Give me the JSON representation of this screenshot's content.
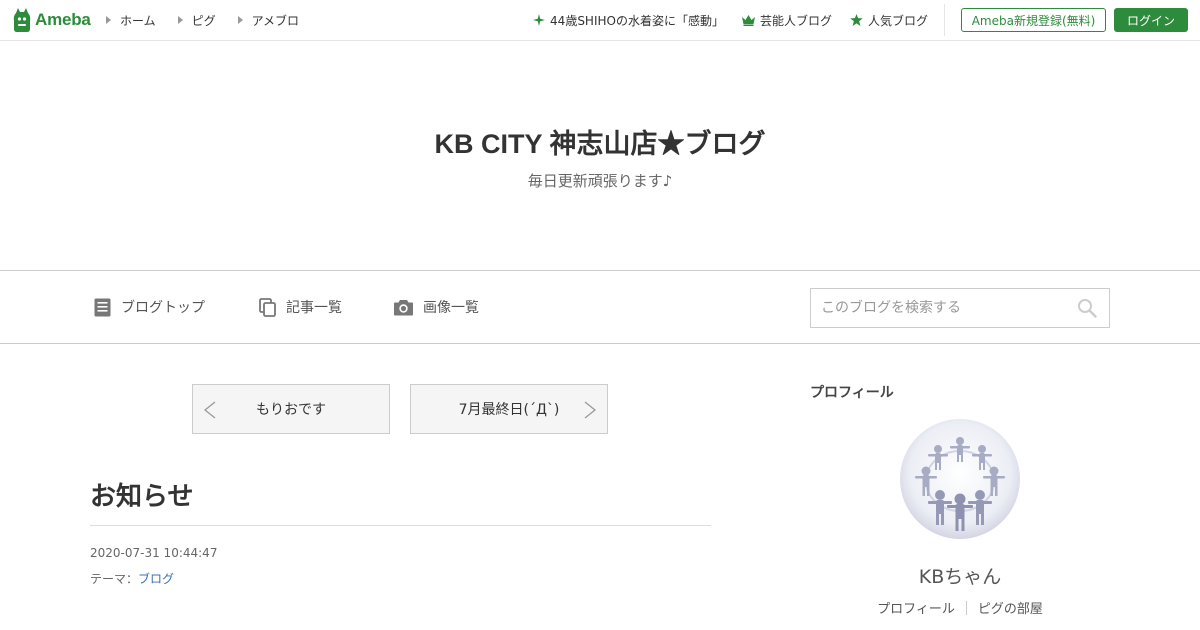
{
  "header": {
    "logo_text": "Ameba",
    "nav": [
      {
        "label": "ホーム"
      },
      {
        "label": "ピグ"
      },
      {
        "label": "アメブロ"
      }
    ],
    "links": [
      {
        "label": "44歳SHIHOの水着姿に「感動」",
        "icon": "sparkle-icon"
      },
      {
        "label": "芸能人ブログ",
        "icon": "crown-icon"
      },
      {
        "label": "人気ブログ",
        "icon": "star-icon"
      }
    ],
    "register_label": "Ameba新規登録(無料)",
    "login_label": "ログイン",
    "brand_color": "#2d8c3c"
  },
  "blog": {
    "title": "KB CITY 神志山店★ブログ",
    "subtitle": "毎日更新頑張ります♪"
  },
  "blog_nav": {
    "items": [
      {
        "label": "ブログトップ",
        "icon": "document-icon"
      },
      {
        "label": "記事一覧",
        "icon": "copy-icon"
      },
      {
        "label": "画像一覧",
        "icon": "camera-icon"
      }
    ],
    "search_placeholder": "このブログを検索する"
  },
  "entry": {
    "prev_label": "もりおです",
    "next_label": "7月最終日(´Д`)",
    "title": "お知らせ",
    "date": "2020-07-31 10:44:47",
    "theme_prefix": "テーマ：",
    "theme_link": "ブログ",
    "link_color": "#3970b5"
  },
  "sidebar": {
    "heading": "プロフィール",
    "profile_name": "KBちゃん",
    "profile_link": "プロフィール",
    "pig_room_link": "ピグの部屋"
  }
}
